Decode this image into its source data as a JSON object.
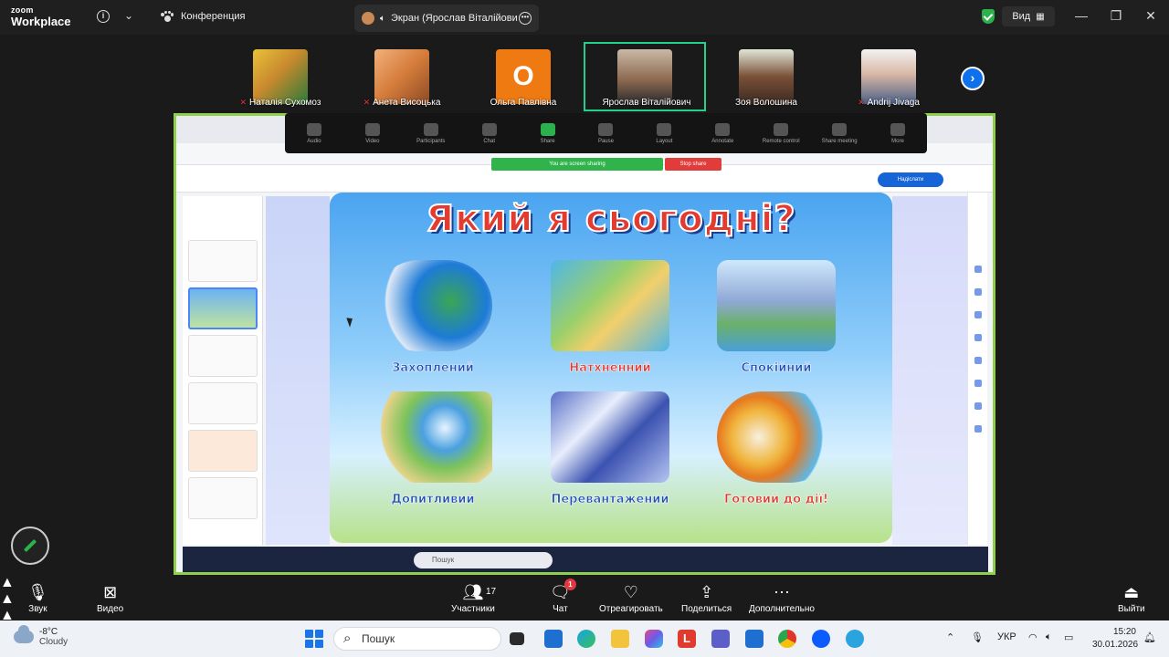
{
  "titlebar": {
    "logo_line1": "zoom",
    "logo_line2": "Workplace",
    "meeting_name": "Конференция",
    "share_tab": "Экран (Ярослав Віталійови",
    "view_label": "Вид"
  },
  "participants": [
    {
      "name": "Наталія Сухомоз",
      "muted": true,
      "tile": "photo"
    },
    {
      "name": "Анета Висоцька",
      "muted": true,
      "tile": "photo"
    },
    {
      "name": "Ольга Павлівна",
      "muted": false,
      "tile": "initial",
      "initial": "О",
      "color": "#f07a12"
    },
    {
      "name": "Ярослав Віталійович",
      "muted": false,
      "tile": "photo",
      "active": true
    },
    {
      "name": "Зоя Волошина",
      "muted": false,
      "tile": "photo"
    },
    {
      "name": "Andrij Jivaga",
      "muted": true,
      "tile": "photo"
    }
  ],
  "shared_screen": {
    "zoom_toolbar": [
      "Audio",
      "Video",
      "Participants",
      "Chat",
      "Share",
      "Pause",
      "Layout",
      "Annotate",
      "Remote control",
      "Share meeting",
      "More"
    ],
    "sharing_banner": "You are screen sharing",
    "stop_label": "Stop share",
    "nav_pill": "Надіслати",
    "slide_title": "Який я сьогодні?",
    "moods": [
      {
        "label": "Захоплений",
        "color": "#1f4fb5"
      },
      {
        "label": "Натхненний",
        "color": "#e0352b"
      },
      {
        "label": "Спокійний",
        "color": "#1f4fb5"
      },
      {
        "label": "Допитливий",
        "color": "#1f4fb5"
      },
      {
        "label": "Перевантажений",
        "color": "#1f4fb5"
      },
      {
        "label": "Готовий до дії!",
        "color": "#e0352b"
      }
    ],
    "inner_search": "Пошук"
  },
  "controls": {
    "audio": "Звук",
    "video": "Видео",
    "participants": "Участники",
    "participants_count": "17",
    "chat": "Чат",
    "chat_badge": "1",
    "react": "Отреагировать",
    "share": "Поделиться",
    "more": "Дополнительно",
    "leave": "Выйти"
  },
  "taskbar": {
    "temp": "-8°C",
    "weather": "Cloudy",
    "search_placeholder": "Пошук",
    "lang": "УКР",
    "time": "15:20",
    "date": "30.01.2026"
  }
}
